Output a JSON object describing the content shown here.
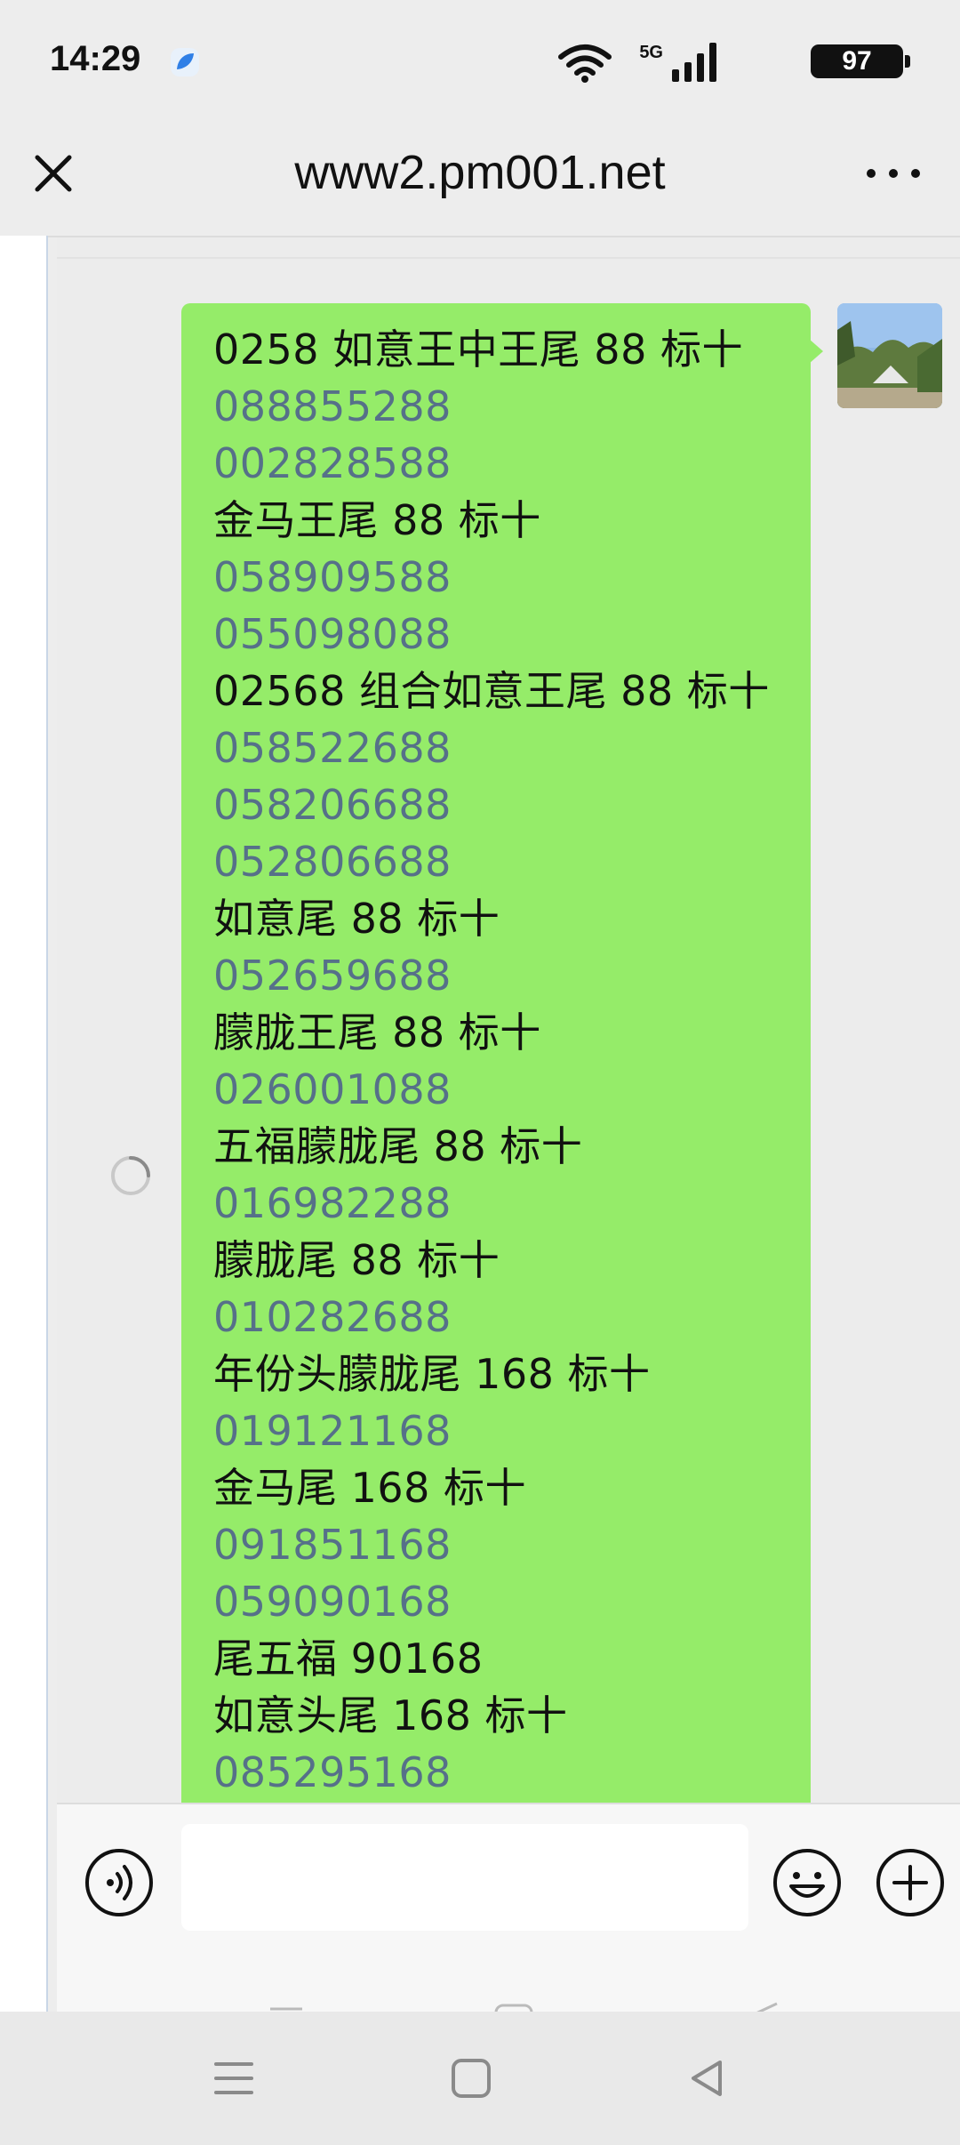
{
  "status_bar": {
    "time": "14:29",
    "network": "5G",
    "battery": "97"
  },
  "header": {
    "title": "www2.pm001.net",
    "close_icon": "close-icon",
    "more_icon": "more-icon"
  },
  "message": {
    "lines": [
      {
        "text": "0258 如意王中王尾 88 标十",
        "kind": "text"
      },
      {
        "text": "088855288",
        "kind": "num"
      },
      {
        "text": "002828588",
        "kind": "num"
      },
      {
        "text": "金马王尾 88 标十",
        "kind": "text"
      },
      {
        "text": "058909588",
        "kind": "num"
      },
      {
        "text": "055098088",
        "kind": "num"
      },
      {
        "text": "02568 组合如意王尾 88 标十",
        "kind": "text"
      },
      {
        "text": "058522688",
        "kind": "num"
      },
      {
        "text": "058206688",
        "kind": "num"
      },
      {
        "text": "052806688",
        "kind": "num"
      },
      {
        "text": "如意尾 88 标十",
        "kind": "text"
      },
      {
        "text": "052659688",
        "kind": "num"
      },
      {
        "text": "朦胧王尾 88 标十",
        "kind": "text"
      },
      {
        "text": "026001088",
        "kind": "num"
      },
      {
        "text": "五福朦胧尾 88 标十",
        "kind": "text"
      },
      {
        "text": "016982288",
        "kind": "num"
      },
      {
        "text": "朦胧尾 88 标十",
        "kind": "text"
      },
      {
        "text": "010282688",
        "kind": "num"
      },
      {
        "text": "年份头朦胧尾 168 标十",
        "kind": "text"
      },
      {
        "text": "019121168",
        "kind": "num"
      },
      {
        "text": "金马尾 168 标十",
        "kind": "text"
      },
      {
        "text": "091851168",
        "kind": "num"
      },
      {
        "text": "059090168",
        "kind": "num"
      },
      {
        "text": "尾五福 90168",
        "kind": "text"
      },
      {
        "text": "如意头尾 168 标十",
        "kind": "text"
      },
      {
        "text": "085295168",
        "kind": "num"
      }
    ]
  },
  "input": {
    "value": "",
    "placeholder": ""
  },
  "colors": {
    "bubble": "#95ec69",
    "number_text": "#567089",
    "background": "#ececec"
  }
}
